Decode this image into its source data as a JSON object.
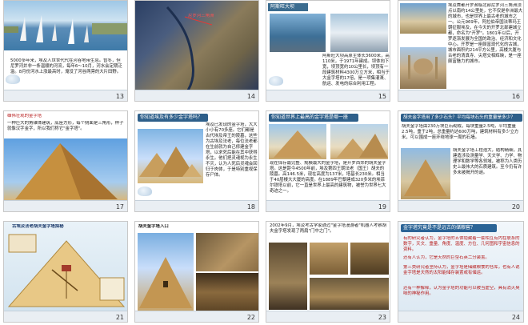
{
  "slides": [
    {
      "num": "13",
      "text": "5000多年来，埃及人世世代代在河谷地带生息。暂冬，但尼罗河并非一条温顺的河流，每年6～10月，河水会定期泛滥。8月份河水上涨最高时，淹没了河谷两旁的大片田野。"
    },
    {
      "num": "14",
      "label": "尼罗河三角洲"
    },
    {
      "num": "15",
      "title": "阿斯旺大坝",
      "text": "阿斯旺大坝高原主体长3600米，高110米，于1971年建成。坝体向下宽，坝顶宽约10公里长，坝顶有一段建筑材料4300万立方米，相当于大金字塔的17倍，是一项集灌溉、航运、发电的综合利用工程。"
    },
    {
      "num": "16",
      "text": "埃及首都开罗濒临北部尼罗河三角洲顶点以南约14公里处，它不仅是非洲最大的城市，也是世界上最古老的城市之一。公元969年，阿拉伯帝国法蒂玛王朝征服埃及，在今天的开罗北部建城立都，命名为\"开罗\"。1801年以后，开罗逐渐发展为全国的政治、经济和文化中心。开罗是一座颇富现代化的古城，城市面积约214平方公里，高楼大厦与古老的清真寺、尖塔交相辉映，是一座颇富魅力的城市。"
    },
    {
      "num": "17",
      "title": "雄伟壮观的金字塔",
      "text": "一种巨大的角锥体建筑，底座方形，每个侧面是三角形，样子就像汉字金字，所以我们称它\"金字塔\"。"
    },
    {
      "num": "18",
      "question": "你知道埃及有多少金字塔吗？",
      "text": "埃及已发现的金字塔，大大小小有70多座。它们都是古代埃及帝王的陵墓，这些为古埃及法老，每位法老都在生前就为自己修建金字塔，以求死后能在其中获得永生。他们把灵魂视为永生不灭，认为人死后灵魂会回归于肉体，于是特别重视保存尸体。"
    },
    {
      "num": "19",
      "question": "你知道世界上最高的金字塔是哪一座么？",
      "text": "现在保存最完整、规模最大的金字塔，是开罗西郊的胡夫金字塔。这是距今4500年前，埃及第四王朝法老（国王）胡夫的陵墓。高146.5米，现在高度为137米，塔基长230米。相当于40层楼大大厦的高度。在1889年巴黎建成320多米的埃菲尔铁塔以前，它一直是世界上最高的建筑物，被誉为世界七大奇迹之一。"
    },
    {
      "num": "20",
      "question": "胡夫金字塔用了多少石头？平均每块石头的重量是多少？",
      "text": "胡夫金字塔由230万块巨石砌成，每块重量2.5吨，平均重量2.5吨，重于2吨，总重量约达600万吨，建筑材料有多少立方米，可以围成一座环绕地球一周的石墙。",
      "text2": "胡夫金字塔工程浩大，结构精细，其建造涉及测量学、天文学、力学、物理学和数学等各领域，被称为人类历史上最伟大的石质建筑。至今仍有许多未被揭开的谜。"
    },
    {
      "num": "21",
      "title": "古埃及法老胡夫金字塔探秘"
    },
    {
      "num": "22",
      "label": "胡夫金字塔入口"
    },
    {
      "num": "23",
      "text": "2002年9月，埃及考古学家通过\"金字塔漫游者\"机器人考察胡夫金字塔发现了两扇\"门中之门\"。"
    },
    {
      "num": "24",
      "question": "金字塔究竟是不是远古的储粮窖？",
      "text": "有的研究者认为，金字塔的五体隐藏着一套相互有内在联系的数字，天文、重量、角度、温度、方位、几何图和宇宙信息的资料。",
      "text2": "还有人认为，它是天然的巨型石英二分装置。",
      "text3": "第三类研究者坚持认为，金字塔是储藏粮食的仓库，也有人说金字塔是天然的太阳能储存装置或有储运。",
      "text4": "还有一种解释，认为金字塔的功能可以被当虚空，具有消灭臭味的神秘作用。"
    }
  ]
}
